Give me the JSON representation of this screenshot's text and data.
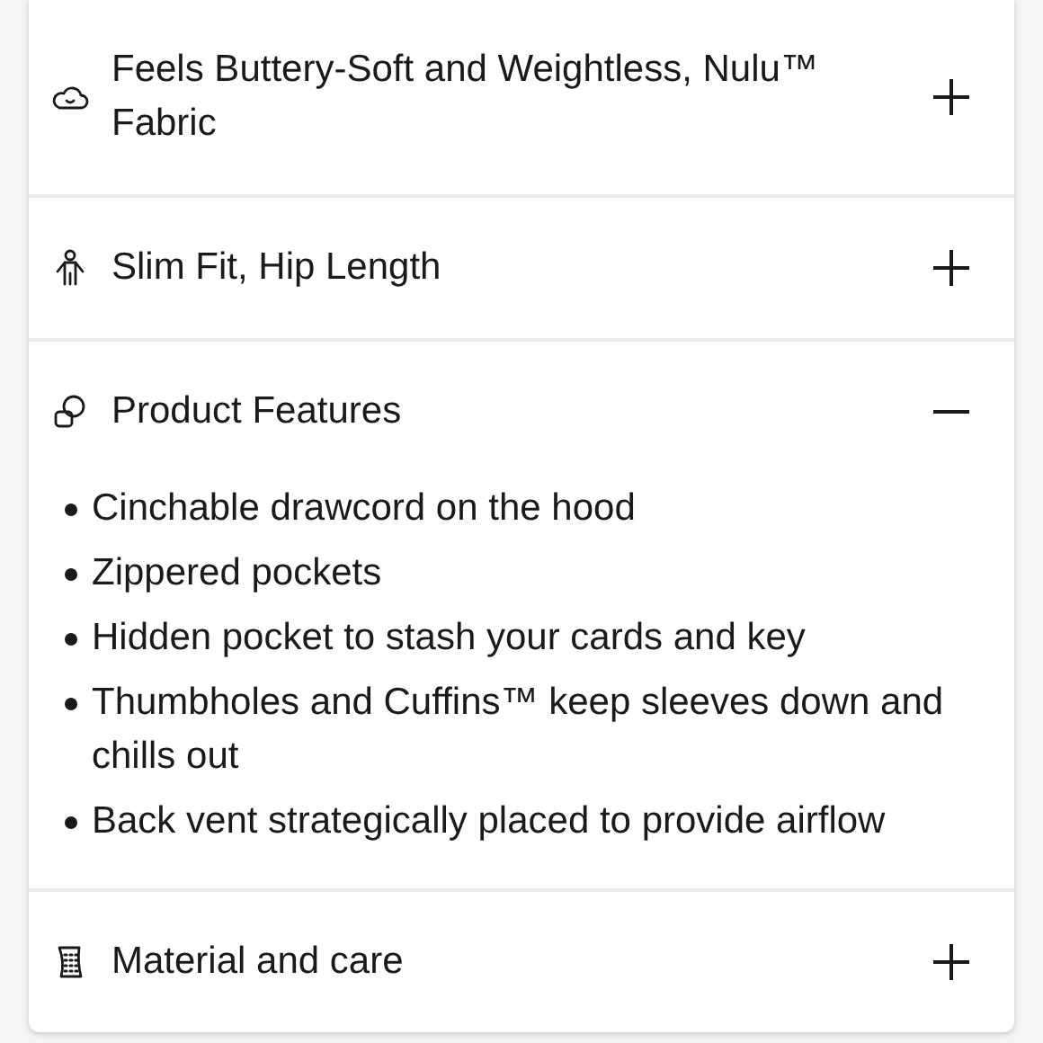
{
  "sections": [
    {
      "kind": "cloud",
      "title": "Feels Buttery-Soft and Weightless, Nulu™ Fabric",
      "expanded": false
    },
    {
      "kind": "figure",
      "title": "Slim Fit, Hip Length",
      "expanded": false
    },
    {
      "kind": "shapes",
      "title": "Product Features",
      "expanded": true,
      "items": [
        "Cinchable drawcord on the hood",
        "Zippered pockets",
        "Hidden pocket to stash your cards and key",
        "Thumbholes and Cuffins™ keep sleeves down and chills out",
        "Back vent strategically placed to provide airflow"
      ]
    },
    {
      "kind": "fabric",
      "title": "Material and care",
      "expanded": false
    }
  ]
}
